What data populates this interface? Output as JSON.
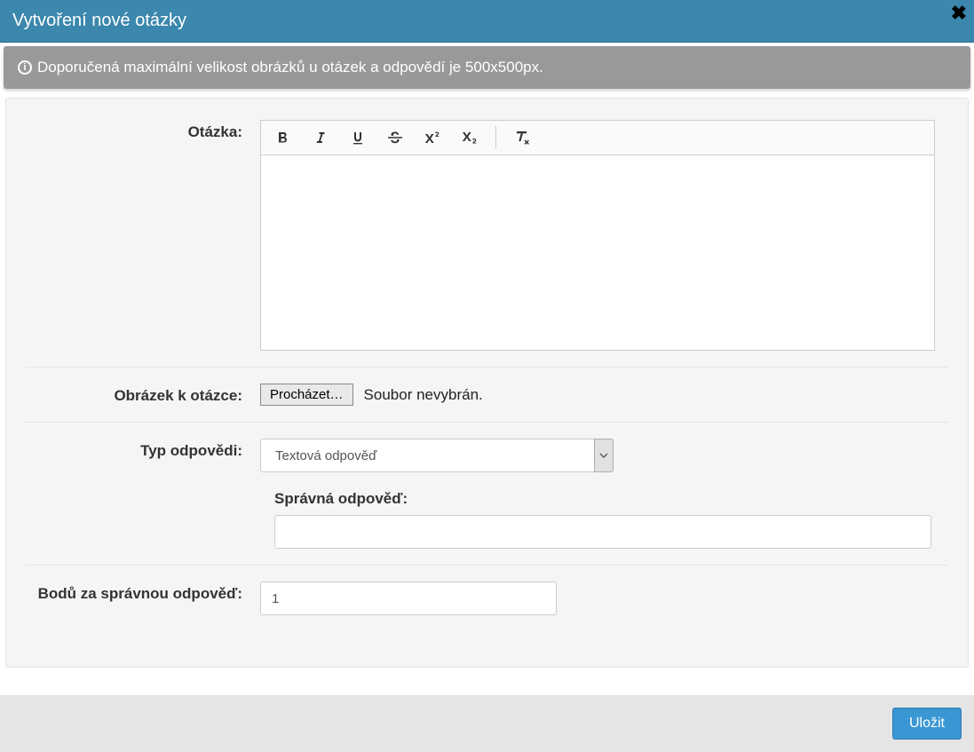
{
  "header": {
    "title": "Vytvoření nové otázky"
  },
  "alert": {
    "text": "Doporučená maximální velikost obrázků u otázek a odpovědí je 500x500px."
  },
  "form": {
    "question_label": "Otázka:",
    "image_label": "Obrázek k otázce:",
    "browse_label": "Procházet…",
    "file_status": "Soubor nevybrán.",
    "answer_type_label": "Typ odpovědi:",
    "answer_type_selected": "Textová odpověď",
    "correct_answer_label": "Správná odpověď:",
    "correct_answer_value": "",
    "points_label": "Bodů za správnou odpověď:",
    "points_value": "1"
  },
  "footer": {
    "save_label": "Uložit"
  },
  "icons": {
    "info": "i"
  }
}
